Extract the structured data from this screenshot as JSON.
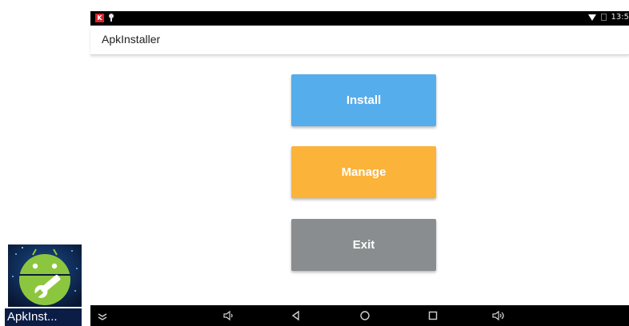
{
  "status_bar": {
    "notification_icons": [
      "k-app-icon",
      "pin-icon"
    ],
    "status_icons": [
      "wifi-icon",
      "signal-icon"
    ],
    "time": "13:5"
  },
  "action_bar": {
    "title": "ApkInstaller"
  },
  "buttons": {
    "install": "Install",
    "manage": "Manage",
    "exit": "Exit"
  },
  "nav_bar": {
    "icons": [
      "nav-menu-icon",
      "volume-down-icon",
      "back-icon",
      "home-icon",
      "recents-icon",
      "volume-up-icon"
    ]
  },
  "shortcut": {
    "label": "ApkInst...",
    "icon": "android-wrench-icon"
  },
  "colors": {
    "install": "#56adeb",
    "manage": "#fbb33a",
    "exit": "#8a8d8f",
    "android_green": "#8cc63f"
  }
}
